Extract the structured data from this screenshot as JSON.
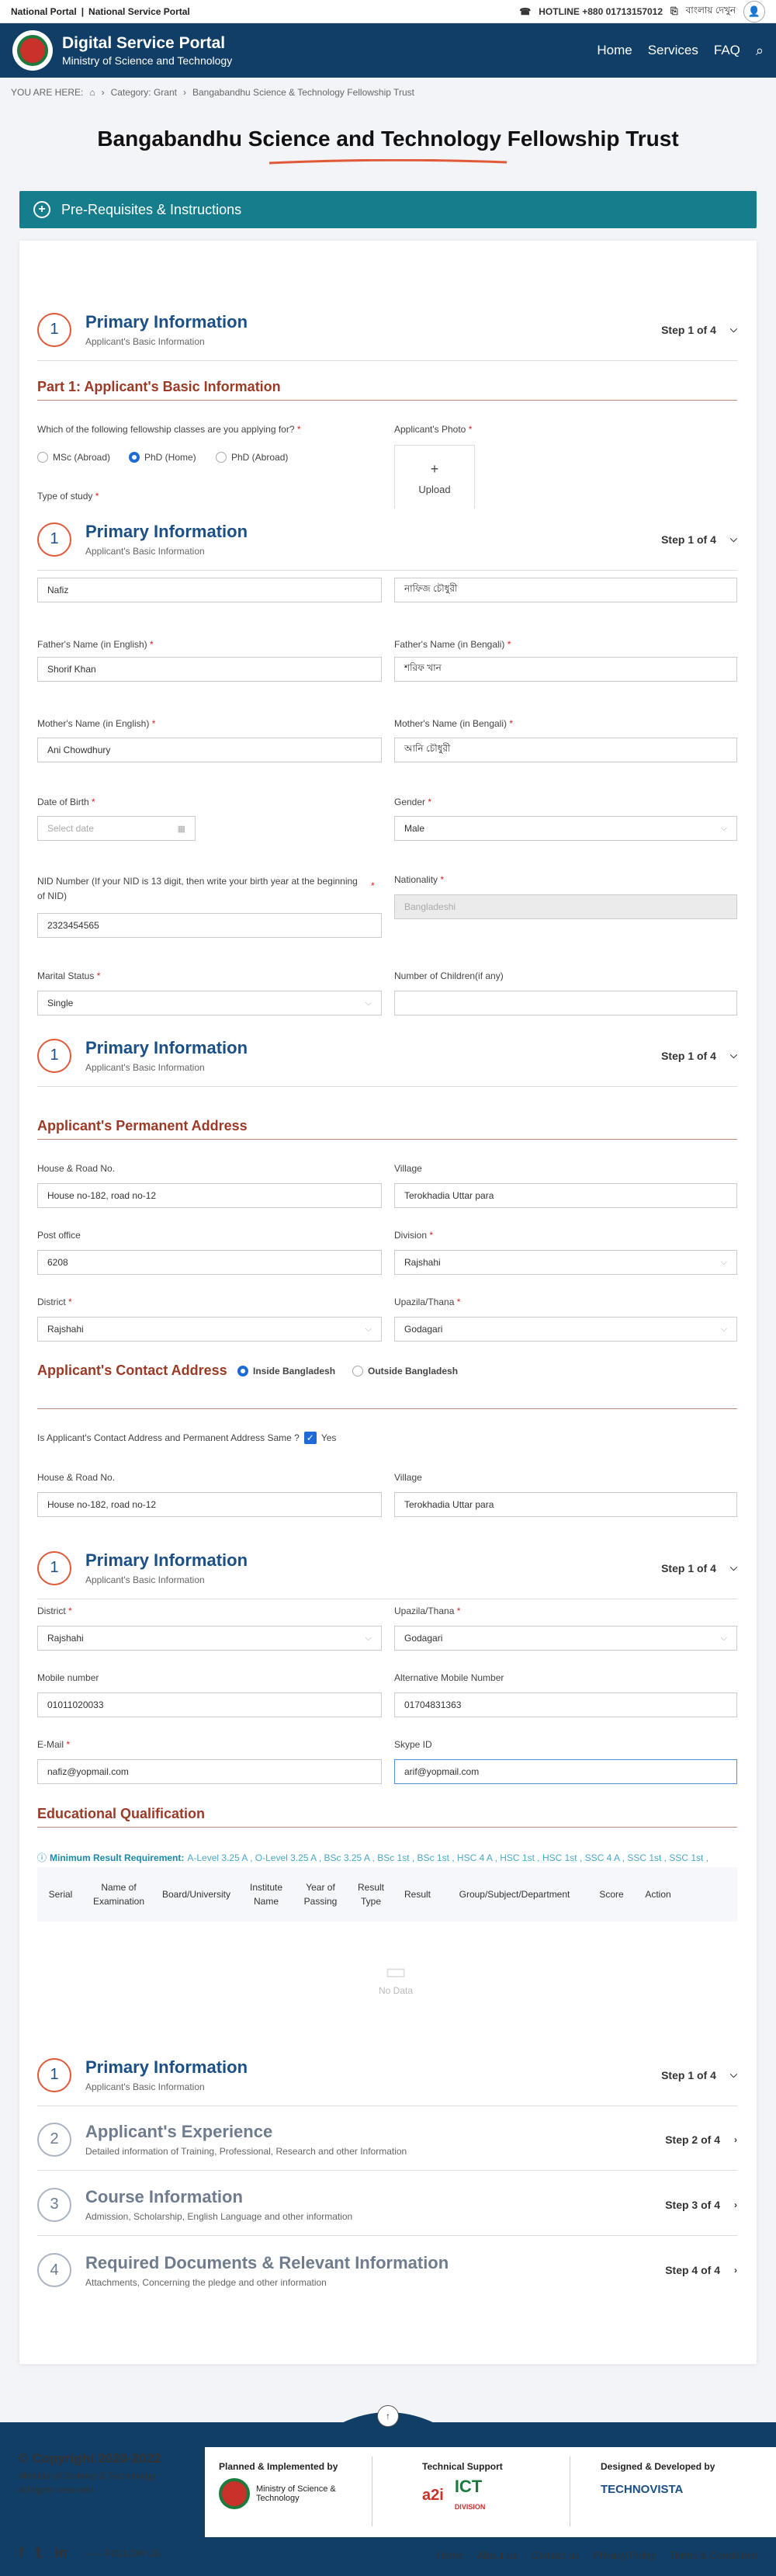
{
  "topbar": {
    "national_portal": "National Portal",
    "national_service": "National Service Portal",
    "hotline": "HOTLINE +880 01713157012",
    "bangla": "বাংলায় দেখুন"
  },
  "header": {
    "title": "Digital Service Portal",
    "subtitle": "Ministry of Science and Technology",
    "nav": [
      "Home",
      "Services",
      "FAQ"
    ]
  },
  "breadcrumb": {
    "you_are": "YOU ARE HERE:",
    "category": "Category: Grant",
    "current": "Bangabandhu Science & Technology Fellowship Trust"
  },
  "page_title": "Bangabandhu Science and Technology Fellowship Trust",
  "prereq": "Pre-Requisites & Instructions",
  "step1": {
    "num": "1",
    "title": "Primary Information",
    "sub": "Applicant's Basic Information",
    "step": "Step 1 of 4"
  },
  "steps": [
    {
      "num": "2",
      "title": "Applicant's Experience",
      "sub": "Detailed information of Training, Professional, Research and other Information",
      "step": "Step 2 of 4"
    },
    {
      "num": "3",
      "title": "Course Information",
      "sub": "Admission, Scholarship, English Language and other information",
      "step": "Step 3 of 4"
    },
    {
      "num": "4",
      "title": "Required Documents & Relevant Information",
      "sub": "Attachments, Concerning the pledge and other information",
      "step": "Step 4 of 4"
    }
  ],
  "part1": "Part 1: Applicant's Basic Information",
  "fellowship": {
    "label": "Which of the following fellowship classes are you applying for?",
    "options": [
      "MSc (Abroad)",
      "PhD (Home)",
      "PhD (Abroad)"
    ],
    "selected": "PhD (Home)"
  },
  "photo": {
    "label": "Applicant's Photo",
    "upload": "Upload"
  },
  "type_of_study": "Type of study",
  "fields": {
    "name_en": "Nafiz",
    "name_bn": "নাফিজ চৌধুরী",
    "father_en_label": "Father's Name (in English)",
    "father_en": "Shorif Khan",
    "father_bn_label": "Father's Name (in Bengali)",
    "father_bn": "শরিফ খান",
    "mother_en_label": "Mother's Name (in English)",
    "mother_en": "Ani Chowdhury",
    "mother_bn_label": "Mother's Name (in Bengali)",
    "mother_bn": "আনি চৌধুরী",
    "dob_label": "Date of Birth",
    "dob_placeholder": "Select date",
    "gender_label": "Gender",
    "gender": "Male",
    "nid_label": "NID Number (If your NID is 13 digit, then write your birth year at the beginning of NID)",
    "nid": "2323454565",
    "nationality_label": "Nationality",
    "nationality": "Bangladeshi",
    "marital_label": "Marital Status",
    "marital": "Single",
    "children_label": "Number of Children(if any)"
  },
  "perm": {
    "title": "Applicant's Permanent Address",
    "house_label": "House & Road No.",
    "house": "House no-182, road no-12",
    "village_label": "Village",
    "village": "Terokhadia Uttar para",
    "post_label": "Post office",
    "post": "6208",
    "division_label": "Division",
    "division": "Rajshahi",
    "district_label": "District",
    "district": "Rajshahi",
    "upazila_label": "Upazila/Thana",
    "upazila": "Godagari"
  },
  "contact": {
    "title": "Applicant's Contact Address",
    "inside": "Inside Bangladesh",
    "outside": "Outside Bangladesh",
    "same_q": "Is Applicant's Contact Address and Permanent Address Same ?",
    "yes": "Yes",
    "house_label": "House & Road No.",
    "house": "House no-182, road no-12",
    "village_label": "Village",
    "village": "Terokhadia Uttar para",
    "district_label": "District",
    "district": "Rajshahi",
    "upazila_label": "Upazila/Thana",
    "upazila": "Godagari",
    "mobile_label": "Mobile number",
    "mobile": "01011020033",
    "alt_label": "Alternative Mobile Number",
    "alt": "01704831363",
    "email_label": "E-Mail",
    "email": "nafiz@yopmail.com",
    "skype_label": "Skype ID",
    "skype": "arif@yopmail.com"
  },
  "edu": {
    "title": "Educational Qualification",
    "min_label": "Minimum Result Requirement:",
    "min_values": "A-Level 3.25 A , O-Level 3.25 A , BSc 3.25 A , BSc 1st , BSc 1st , HSC 4 A , HSC 1st , HSC 1st , SSC 4 A , SSC 1st , SSC 1st ,",
    "columns": [
      "Serial",
      "Name of Examination",
      "Board/University",
      "Institute Name",
      "Year of Passing",
      "Result Type",
      "Result",
      "Group/Subject/Department",
      "Score",
      "Action"
    ],
    "no_data": "No Data"
  },
  "footer": {
    "copyright": "© Copyright 2020-2022",
    "ministry": "Ministry of Science & Technology",
    "rights": "All rights reserved",
    "planned": "Planned & Implemented by",
    "planned_org": "Ministry of Science & Technology",
    "tech": "Technical Support",
    "a2i": "a2i",
    "ict": "ICT",
    "ict_sub": "DIVISION",
    "designed": "Designed & Developed by",
    "technovista": "TECHNOVISTA",
    "follow": "FOLLOW US",
    "links": [
      "Home",
      "About us",
      "Contact us",
      "Privacy Policy",
      "Terms & Conditions"
    ]
  }
}
